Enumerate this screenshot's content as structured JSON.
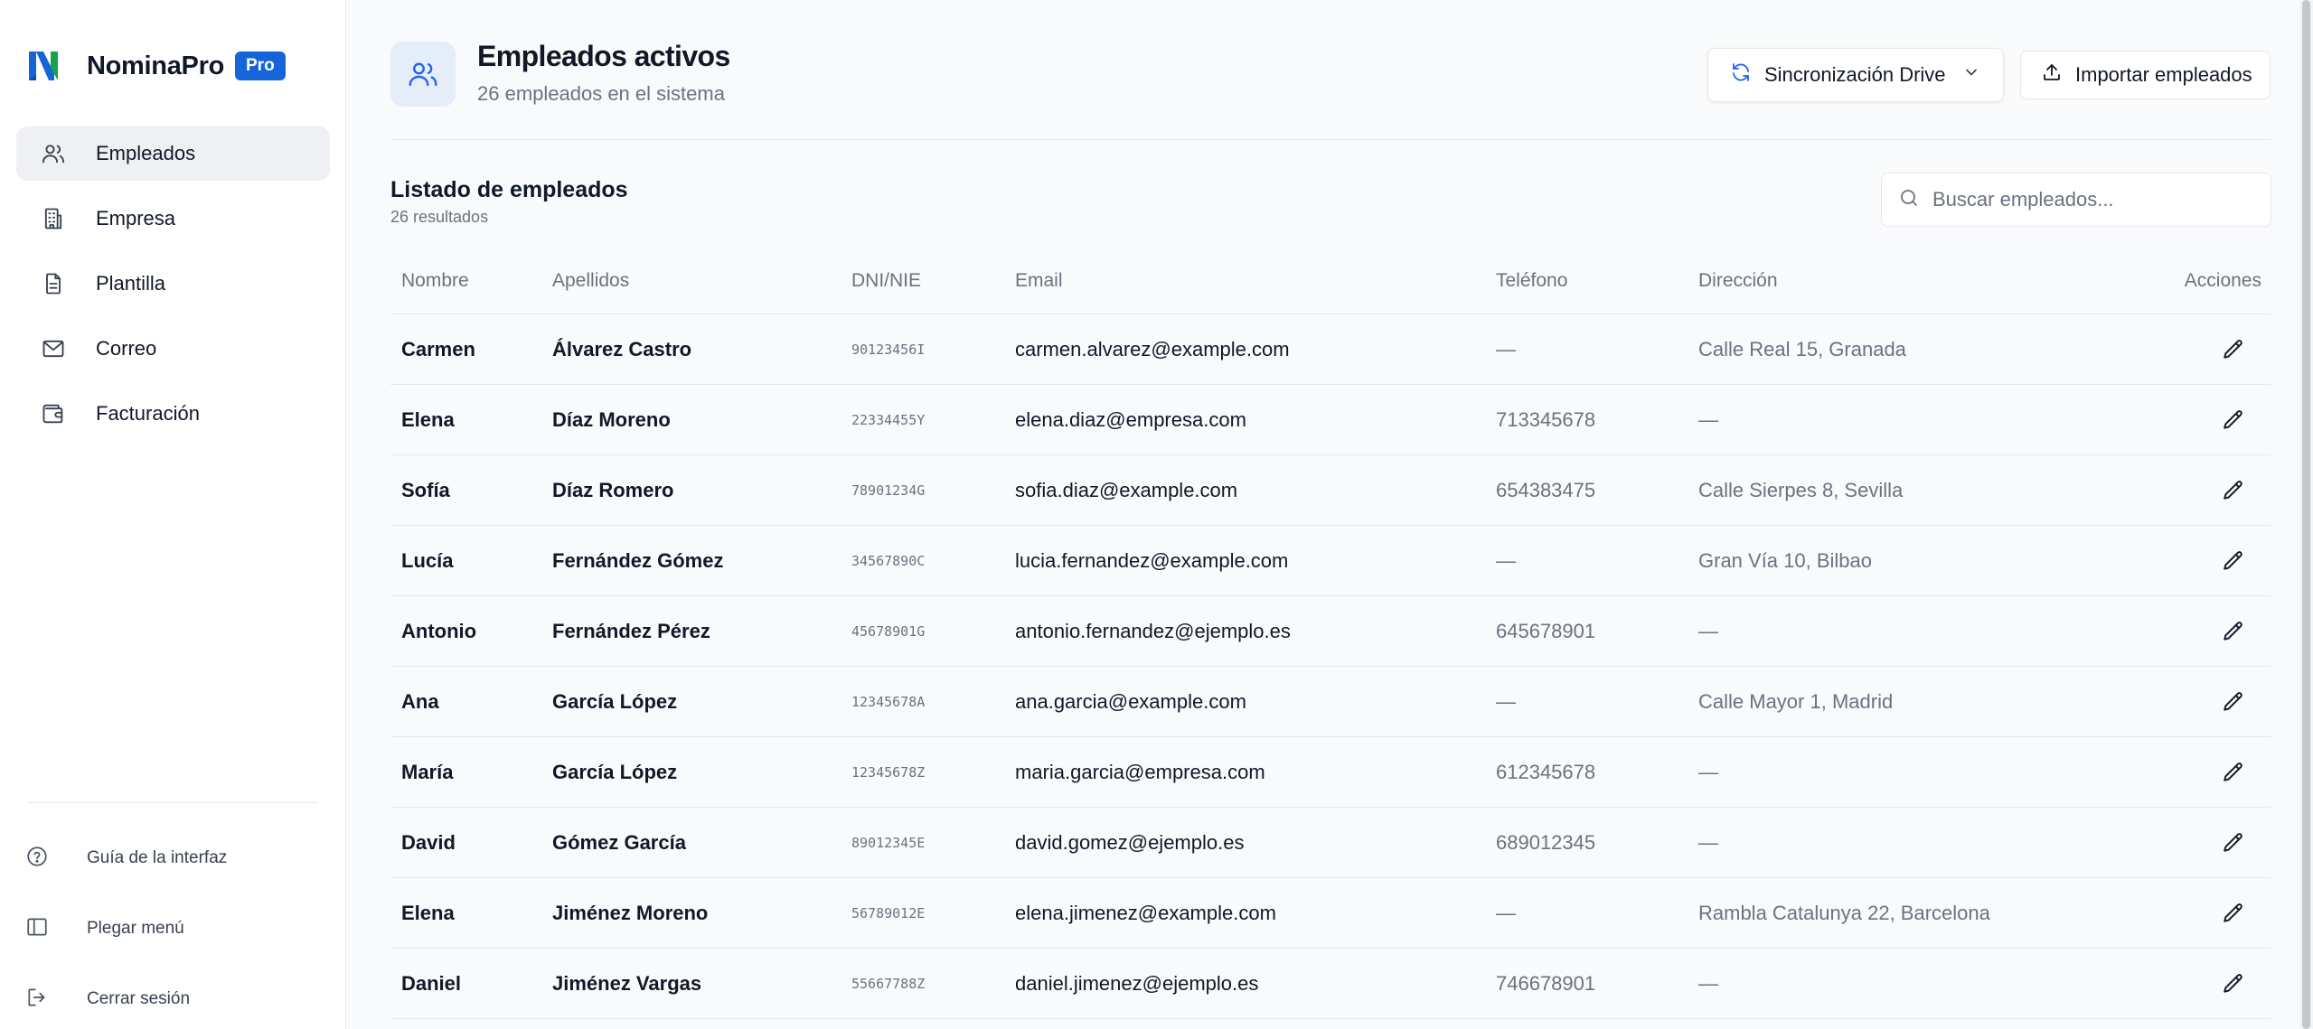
{
  "brand": {
    "name": "NominaPro",
    "badge": "Pro",
    "logo_colors": [
      "#1565d8",
      "#16a34a"
    ]
  },
  "sidebar": {
    "items": [
      {
        "label": "Empleados",
        "icon": "users-icon",
        "active": true
      },
      {
        "label": "Empresa",
        "icon": "building-icon",
        "active": false
      },
      {
        "label": "Plantilla",
        "icon": "document-icon",
        "active": false
      },
      {
        "label": "Correo",
        "icon": "mail-icon",
        "active": false
      },
      {
        "label": "Facturación",
        "icon": "wallet-icon",
        "active": false
      }
    ],
    "footer": [
      {
        "label": "Guía de la interfaz",
        "icon": "help-circle-icon"
      },
      {
        "label": "Plegar menú",
        "icon": "sidebar-toggle-icon"
      },
      {
        "label": "Cerrar sesión",
        "icon": "logout-icon"
      }
    ]
  },
  "header": {
    "title": "Empleados activos",
    "subtitle": "26 empleados en el sistema",
    "sync_label": "Sincronización Drive",
    "import_label": "Importar empleados"
  },
  "list": {
    "title": "Listado de empleados",
    "count": "26 resultados",
    "search_placeholder": "Buscar empleados..."
  },
  "table": {
    "columns": [
      "Nombre",
      "Apellidos",
      "DNI/NIE",
      "Email",
      "Teléfono",
      "Dirección",
      "Acciones"
    ],
    "rows": [
      [
        "Carmen",
        "Álvarez Castro",
        "90123456I",
        "carmen.alvarez@example.com",
        "—",
        "Calle Real 15, Granada"
      ],
      [
        "Elena",
        "Díaz Moreno",
        "22334455Y",
        "elena.diaz@empresa.com",
        "713345678",
        "—"
      ],
      [
        "Sofía",
        "Díaz Romero",
        "78901234G",
        "sofia.diaz@example.com",
        "654383475",
        "Calle Sierpes 8, Sevilla"
      ],
      [
        "Lucía",
        "Fernández Gómez",
        "34567890C",
        "lucia.fernandez@example.com",
        "—",
        "Gran Vía 10, Bilbao"
      ],
      [
        "Antonio",
        "Fernández Pérez",
        "45678901G",
        "antonio.fernandez@ejemplo.es",
        "645678901",
        "—"
      ],
      [
        "Ana",
        "García López",
        "12345678A",
        "ana.garcia@example.com",
        "—",
        "Calle Mayor 1, Madrid"
      ],
      [
        "María",
        "García López",
        "12345678Z",
        "maria.garcia@empresa.com",
        "612345678",
        "—"
      ],
      [
        "David",
        "Gómez García",
        "89012345E",
        "david.gomez@ejemplo.es",
        "689012345",
        "—"
      ],
      [
        "Elena",
        "Jiménez Moreno",
        "56789012E",
        "elena.jimenez@example.com",
        "—",
        "Rambla Catalunya 22, Barcelona"
      ],
      [
        "Daniel",
        "Jiménez Vargas",
        "55667788Z",
        "daniel.jimenez@ejemplo.es",
        "746678901",
        "—"
      ]
    ]
  },
  "colors": {
    "accent": "#1565d8",
    "active_bg": "#eef0f4",
    "muted_text": "#6b7280"
  }
}
